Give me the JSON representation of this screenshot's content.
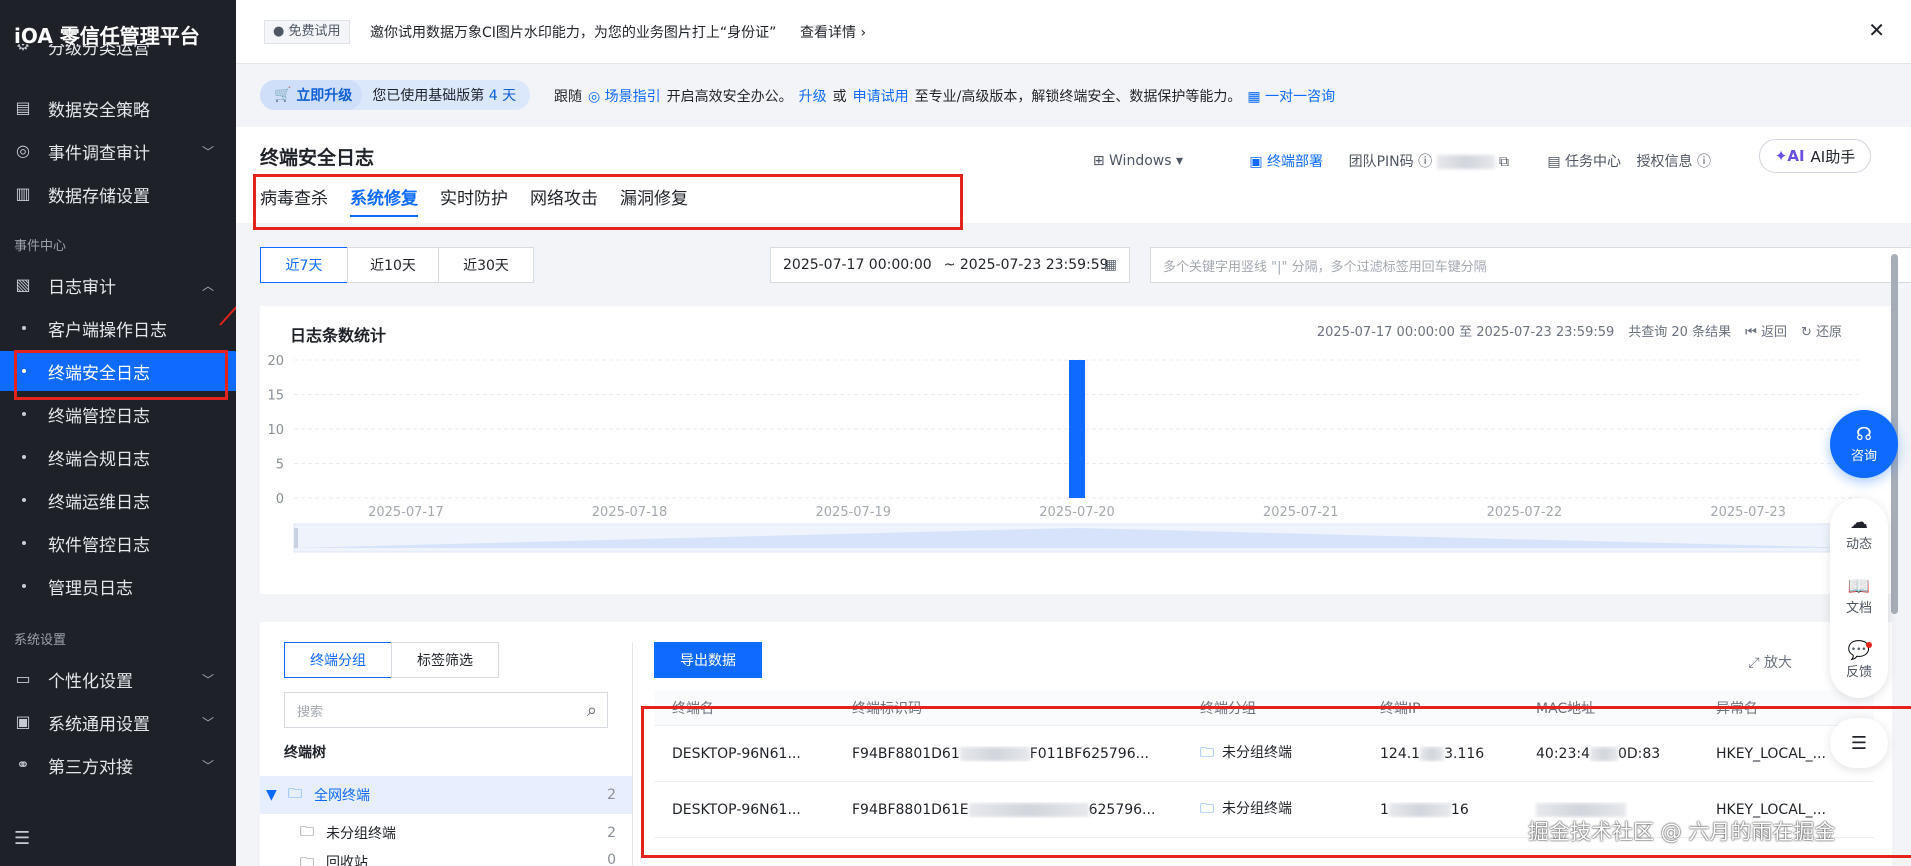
{
  "sidebar": {
    "title": "iOA 零信任管理平台",
    "items": [
      {
        "label": "分级分类运营",
        "icon": "grid-icon"
      },
      {
        "label": "数据安全策略",
        "icon": "database-icon"
      },
      {
        "label": "事件调查审计",
        "icon": "compass-icon"
      },
      {
        "label": "数据存储设置",
        "icon": "storage-icon"
      }
    ],
    "section_event": "事件中心",
    "log_audit": "日志审计",
    "log_items": [
      "客户端操作日志",
      "终端安全日志",
      "终端管控日志",
      "终端合规日志",
      "终端运维日志",
      "软件管控日志",
      "管理员日志"
    ],
    "section_system": "系统设置",
    "system_items": [
      {
        "label": "个性化设置",
        "icon": "monitor-icon"
      },
      {
        "label": "系统通用设置",
        "icon": "settings-icon"
      },
      {
        "label": "第三方对接",
        "icon": "link-icon"
      }
    ]
  },
  "promo": {
    "tag": "免费试用",
    "text": "邀你试用数据万象CI图片水印能力，为您的业务图片打上“身份证”",
    "link": "查看详情"
  },
  "upgrade": {
    "button": "立即升级",
    "text_prefix": "您已使用基础版第",
    "days": "4 天",
    "follow": "跟随",
    "guide": "场景指引",
    "mid": "开启高效安全办公。",
    "up": "升级",
    "or": "或",
    "apply": "申请试用",
    "tail": "至专业/高级版本，解锁终端安全、数据保护等能力。",
    "consult": "一对一咨询"
  },
  "header": {
    "title": "终端安全日志",
    "os": "Windows",
    "deploy": "终端部署",
    "pin": "团队PIN码",
    "task_center": "任务中心",
    "license": "授权信息",
    "ai": "AI助手"
  },
  "tabs": [
    "病毒查杀",
    "系统修复",
    "实时防护",
    "网络攻击",
    "漏洞修复"
  ],
  "toolbar": {
    "ranges": [
      "近7天",
      "近10天",
      "近30天"
    ],
    "start": "2025-07-17 00:00:00",
    "end": "~ 2025-07-23 23:59:59",
    "search_placeholder": "多个关键字用竖线 \"|\" 分隔，多个过滤标签用回车键分隔"
  },
  "chart_card": {
    "title": "日志条数统计",
    "range": "2025-07-17 00:00:00 至 2025-07-23 23:59:59",
    "total": "共查询 20 条结果",
    "back": "返回",
    "restore": "还原"
  },
  "chart_data": {
    "type": "bar",
    "categories": [
      "2025-07-17",
      "2025-07-18",
      "2025-07-19",
      "2025-07-20",
      "2025-07-21",
      "2025-07-22",
      "2025-07-23"
    ],
    "values": [
      0,
      0,
      0,
      20,
      0,
      0,
      0
    ],
    "yticks": [
      0,
      5,
      10,
      15,
      20
    ],
    "ylim": [
      0,
      20
    ],
    "color": "#0f6bff"
  },
  "lower": {
    "tab_group": "终端分组",
    "tab_tag": "标签筛选",
    "search_placeholder": "搜索",
    "tree_title": "终端树",
    "tree": [
      {
        "label": "全网终端",
        "count": "2"
      },
      {
        "label": "未分组终端",
        "count": "2"
      },
      {
        "label": "回收站",
        "count": "0"
      }
    ],
    "export": "导出数据",
    "enlarge": "放大",
    "columns": [
      "终端名",
      "终端标识码",
      "终端分组",
      "终端IP",
      "MAC地址",
      "异常名"
    ],
    "rows": [
      [
        "DESKTOP-96N61...",
        "F94BF8801D61",
        "F011BF625796...",
        "未分组终端",
        "124.1",
        "3.116",
        "40:23:4",
        "0D:83",
        "HKEY_LOCAL_..."
      ],
      [
        "DESKTOP-96N61...",
        "F94BF8801D61E",
        "625796...",
        "未分组终端",
        "1",
        "16",
        "",
        "",
        "HKEY_LOCAL_..."
      ]
    ]
  },
  "floats": {
    "consult": "咨询",
    "dynamic": "动态",
    "docs": "文档",
    "feedback": "反馈"
  },
  "watermark": "掘金技术社区 @ 六月的雨在掘金"
}
